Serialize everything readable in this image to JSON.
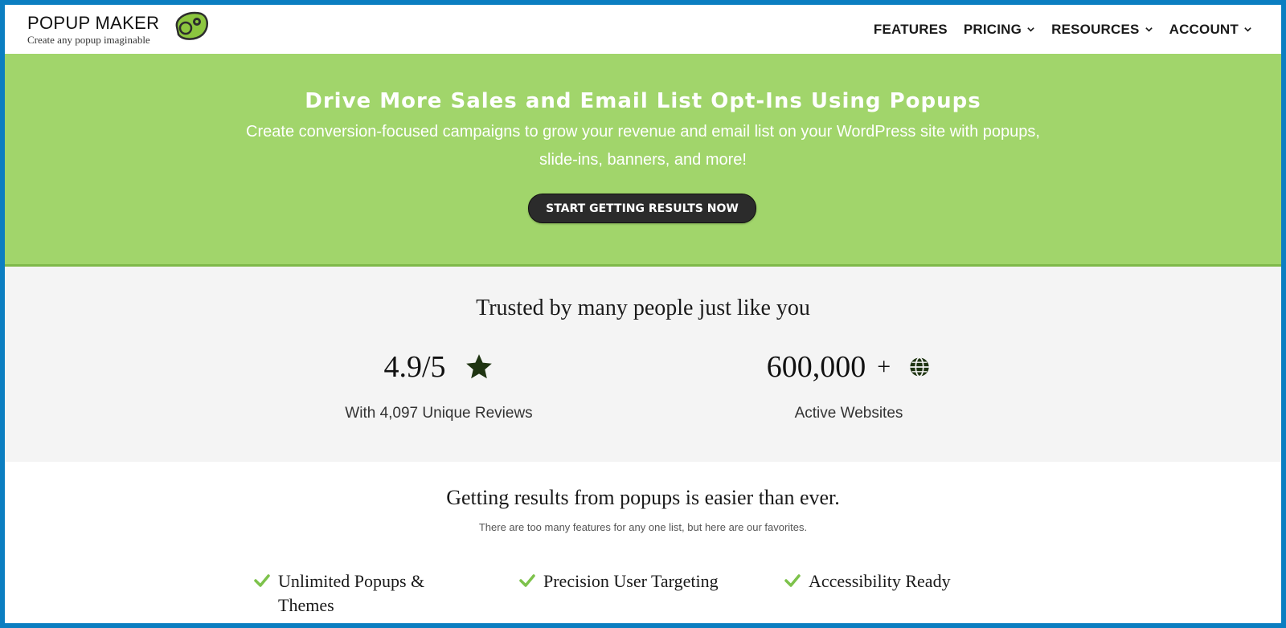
{
  "header": {
    "logo_title": "POPUP MAKER",
    "logo_tagline": "Create any popup imaginable",
    "nav": [
      {
        "label": "FEATURES",
        "has_dropdown": false
      },
      {
        "label": "PRICING",
        "has_dropdown": true
      },
      {
        "label": "RESOURCES",
        "has_dropdown": true
      },
      {
        "label": "ACCOUNT",
        "has_dropdown": true
      }
    ]
  },
  "hero": {
    "title": "Drive More Sales and Email List Opt-Ins Using Popups",
    "subtitle": "Create conversion-focused campaigns to grow your revenue and email list on your WordPress site with popups, slide-ins, banners, and more!",
    "cta_label": "START GETTING RESULTS NOW",
    "background_color": "#a1d56b"
  },
  "trust": {
    "title": "Trusted by many people just like you",
    "stats": [
      {
        "value": "4.9/5",
        "suffix": "",
        "icon": "star-icon",
        "label": "With 4,097 Unique Reviews"
      },
      {
        "value": "600,000",
        "suffix": "+",
        "icon": "globe-icon",
        "label": "Active Websites"
      }
    ]
  },
  "features": {
    "title": "Getting results from popups is easier than ever.",
    "subtitle": "There are too many features for any one list, but here are our favorites.",
    "items": [
      {
        "label": "Unlimited Popups & Themes",
        "icon": "check-icon"
      },
      {
        "label": "Precision User Targeting",
        "icon": "check-icon"
      },
      {
        "label": "Accessibility Ready",
        "icon": "check-icon"
      }
    ],
    "check_color": "#7dc24b"
  },
  "colors": {
    "frame_border": "#0b7ec1",
    "cta_background": "#2b2b2b",
    "trust_background": "#f4f4f4"
  }
}
